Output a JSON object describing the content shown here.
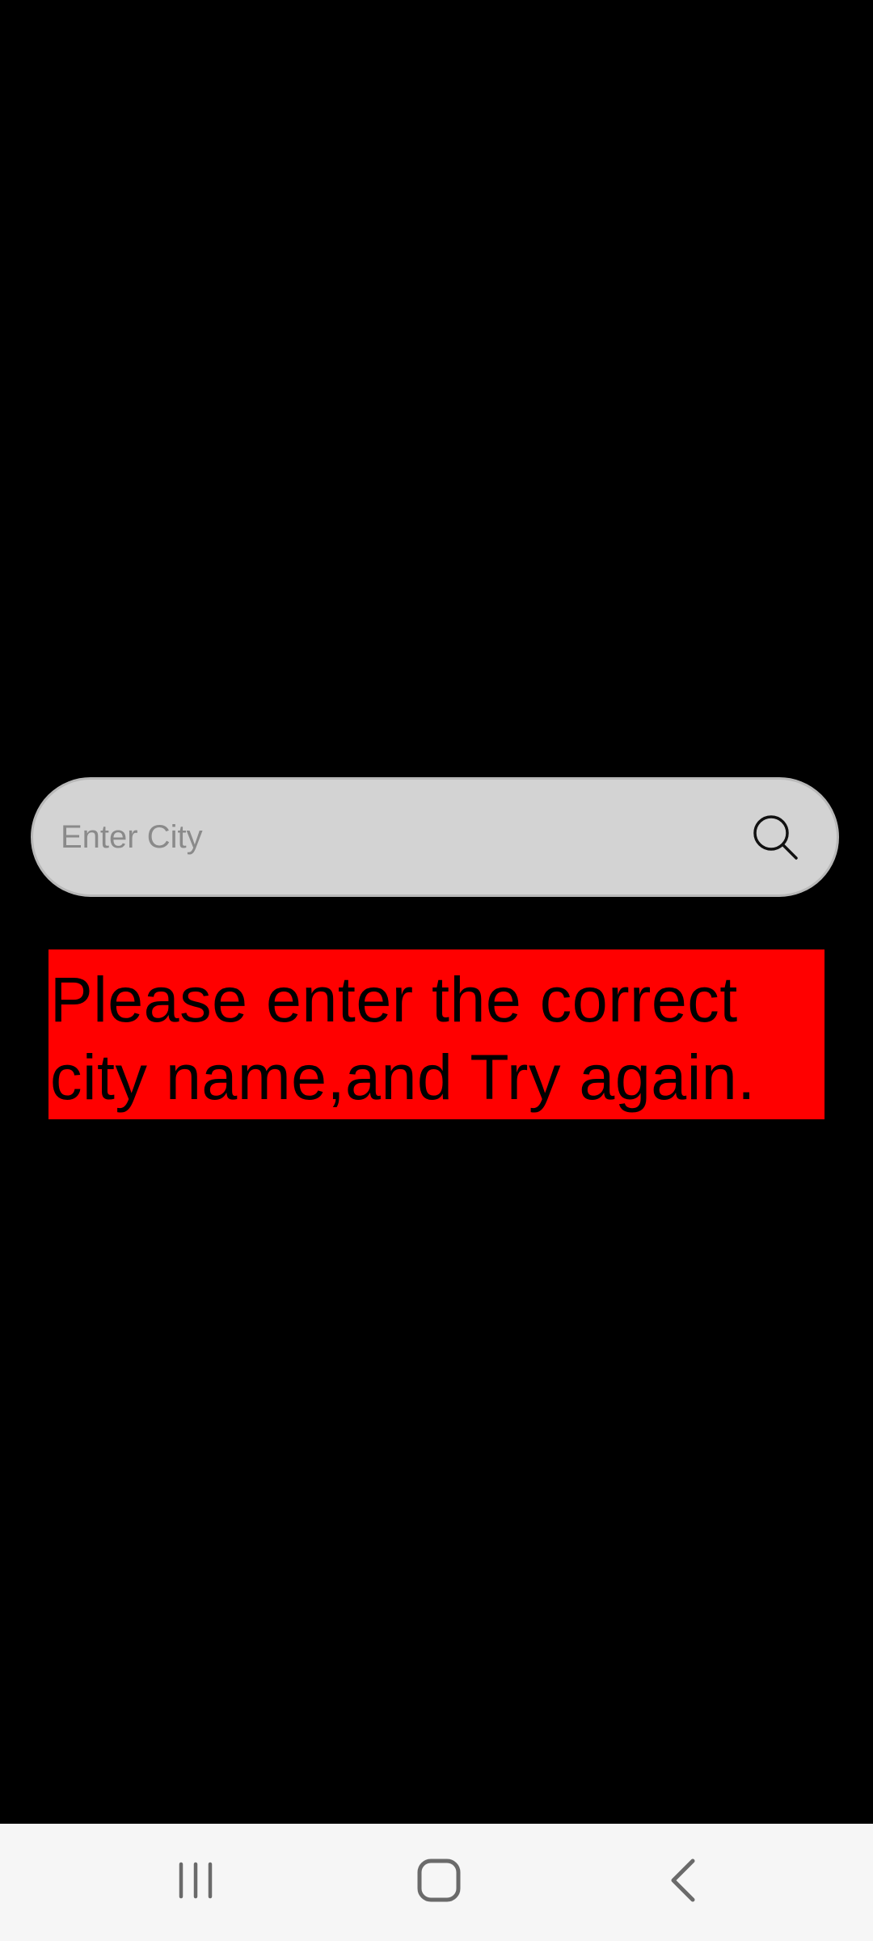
{
  "search": {
    "placeholder": "Enter City",
    "value": "",
    "icon": "search-icon"
  },
  "error": {
    "message": "Please enter the correct city name,and Try again.",
    "background_color": "#ff0000",
    "text_color": "#000000"
  },
  "navigation": {
    "recents_icon": "recents-icon",
    "home_icon": "home-icon",
    "back_icon": "back-icon"
  },
  "colors": {
    "background": "#000000",
    "search_bar": "#d3d3d3",
    "nav_bar": "#f6f6f6"
  }
}
